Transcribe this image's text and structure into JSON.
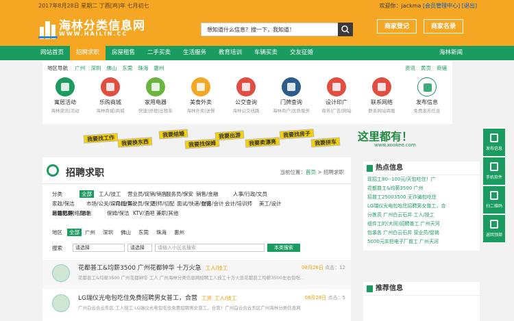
{
  "topbar": {
    "date": "2017年8月28日 星期二  丁酉[鸡]年 七月初七",
    "welcome": "欢迎你：jackma",
    "member_center": "[会员管理中心]",
    "logout": "[退出]"
  },
  "header": {
    "logo_cn": "海林分类信息网",
    "logo_en": "WWW.HAILIN.CC",
    "search_placeholder": "想知道什么信息？搜一下，我知道！",
    "register": "商家登记",
    "directory": "商家名录"
  },
  "nav": {
    "items": [
      "网站首页",
      "招聘求职",
      "房屋租售",
      "二手买卖",
      "生活服务",
      "教育培训",
      "车辆买卖",
      "交友征婚"
    ],
    "active": 1,
    "right": "海林新闻"
  },
  "region": {
    "label": "地区导航",
    "cities": [
      "广州",
      "深圳",
      "佛山",
      "东莞",
      "珠海",
      "惠州"
    ],
    "right": [
      "资讯",
      "黄页",
      "商铺"
    ]
  },
  "categories": [
    {
      "title": "寓居活动",
      "sub": "海林资讯|活动",
      "color": "#1a9b5f"
    },
    {
      "title": "乐购商城",
      "sub": "海林商城|商城",
      "color": "#e24d3f"
    },
    {
      "title": "家用电器",
      "sub": "快速|修理|出租车",
      "color": "#69b53f"
    },
    {
      "title": "美食外卖",
      "sub": "海林外卖|送餐",
      "color": "#f5a623"
    },
    {
      "title": "公交查询",
      "sub": "海林公交线路",
      "color": "#e24d3f"
    },
    {
      "title": "门牌查询",
      "sub": "海林商户|优质服务",
      "color": "#2c5d8a"
    },
    {
      "title": "设计印广",
      "sub": "商务|广告|网站",
      "color": "#e24d3f"
    },
    {
      "title": "联系网络",
      "sub": "联系网站商服",
      "color": "#e24d3f"
    },
    {
      "title": "发布信息",
      "sub": "免费发布信息",
      "color": "#ffffff"
    }
  ],
  "banner": {
    "tags": [
      "我要找工作",
      "我要换东西",
      "我要结婚",
      "我要找保姆",
      "我要出游",
      "我要卖漂亮",
      "我要找房子",
      "我要拼车"
    ],
    "slogan": "这里都有！",
    "site": "www.xookee.com"
  },
  "main": {
    "title": "招聘求职",
    "crumb_prefix": "当前位置：",
    "crumb_home": "首页",
    "crumb_sep": " > ",
    "crumb_cur": "招聘求职",
    "filter_cat_label": "分类",
    "filter_cats": [
      "全部",
      "工人/技工",
      "营业员/促销/销售",
      "服务员/保安",
      "销售/金融",
      "人事/行政/文员",
      "家政/保洁",
      "市场/公关/媒介/会务",
      "司机/驾驶员/保安",
      "厨师/切配",
      "面试/快递/仓管",
      "财务/会计",
      "会计/培训师",
      "美工/设计",
      "计算机/网络/通信",
      "翻译",
      "保姆/保洁",
      "KTV/酒吧",
      "兼职/其他",
      "出国劳务",
      "其他招聘"
    ],
    "filter_area_label": "地区",
    "filter_areas": [
      "全部",
      "广州",
      "深圳",
      "佛山",
      "东莞",
      "珠海",
      "惠州"
    ],
    "search_label": "搜索",
    "select1": "请选择",
    "select2": "请选择",
    "kw_placeholder": "请输入小区名搜索",
    "search_btn": "本类搜索",
    "listings": [
      {
        "title": "花都普工&均薪3500 广州花都钟华 工人/技工 十万火急",
        "badge": "工人/技工",
        "desc": "花都普工&均薪3500 广州花都钟华 工人 广州海林分类信息网招聘工人技工十万火急花都普工均薪3500左右包吃...",
        "date": "08月28日",
        "hits": "点击：12"
      },
      {
        "title": "LG瑞仪光电包吃住免费招聘男女普工，合营",
        "badge": "工资",
        "badge2": "工人/技工",
        "desc": "广州白云合云东区 工人技工 LG瑞仪光电包吃住免费招聘男女普工，合营！广州白云合云东区广州海林分类信息网",
        "date": "08月28日",
        "hits": "点击：5"
      }
    ]
  },
  "hot": {
    "title": "热点信息",
    "items": [
      "现招工80--100元/天包吃住！广",
      "花都普工&均薪3500 广州",
      "招普工25003500 无诈骗包吃住",
      "LG瑞仪光电包吃住招聘男女普工，合",
      "分拣员 广州白云石井 工人/技工",
      "组件工的(大同)招聘普工 广州天河",
      "包装各 广州白云石井 营业员/促销",
      "5000元实拍电子厂普工 广州天河"
    ]
  },
  "rec": {
    "title": "推荐信息"
  },
  "float": [
    "发布信息",
    "手机软件",
    "扫二维码",
    "返回顶部"
  ]
}
